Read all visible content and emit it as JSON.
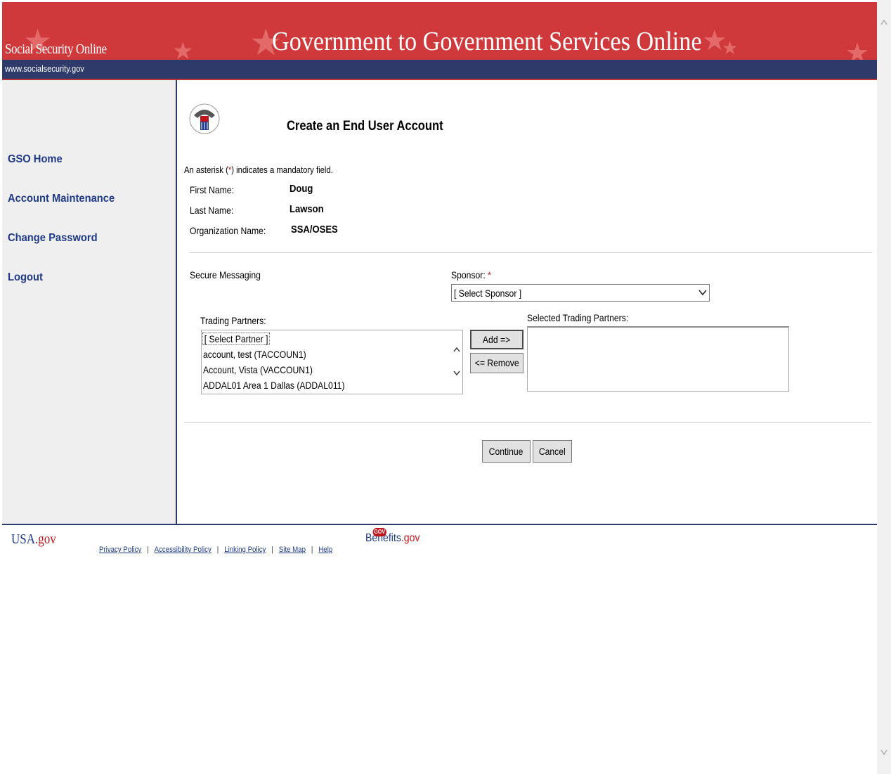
{
  "header": {
    "site_name": "Social Security Online",
    "site_url": "www.socialsecurity.gov",
    "banner_title": "Government to Government Services Online"
  },
  "sidebar": {
    "items": [
      {
        "label": "GSO Home"
      },
      {
        "label": "Account Maintenance"
      },
      {
        "label": "Change Password"
      },
      {
        "label": "Logout"
      }
    ]
  },
  "main": {
    "title": "Create an End User Account",
    "mandatory_note_pre": "An asterisk (",
    "mandatory_note_star": "*",
    "mandatory_note_post": ") indicates a mandatory field.",
    "fields": [
      {
        "label": "First Name:",
        "value": "Doug"
      },
      {
        "label": "Last Name:",
        "value": "Lawson"
      },
      {
        "label": "Organization Name:",
        "value": "SSA/OSES"
      }
    ],
    "secure_messaging_label": "Secure Messaging",
    "sponsor": {
      "label": "Sponsor:",
      "required_mark": "*",
      "selected": "[ Select Sponsor ]"
    },
    "trading_partners": {
      "label": "Trading Partners:",
      "options": [
        "[ Select Partner ]",
        "account, test (TACCOUN1)",
        "Account, Vista (VACCOUN1)",
        "ADDAL01 Area 1 Dallas (ADDAL011)"
      ]
    },
    "selected_trading_partners_label": "Selected Trading Partners:",
    "add_button": "Add =>",
    "remove_button": "<= Remove",
    "continue_button": "Continue",
    "cancel_button": "Cancel"
  },
  "footer": {
    "usa_logo_pre": "USA",
    "usa_logo_post": ".gov",
    "links": [
      "Privacy Policy",
      "Accessibility Policy",
      "Linking Policy",
      "Site Map",
      "Help"
    ],
    "benefits_logo_pre": "Benefits",
    "benefits_logo_post": ".gov",
    "benefits_badge": "GOV"
  },
  "colors": {
    "banner_red": "#d0393b",
    "banner_navy": "#2d3a6a",
    "link_blue": "#1f3a8a",
    "required_red": "#c0161b"
  },
  "icons": [
    "ssa-seal-icon",
    "chevron-down-icon",
    "scroll-up-icon",
    "scroll-down-icon",
    "star-icon"
  ]
}
